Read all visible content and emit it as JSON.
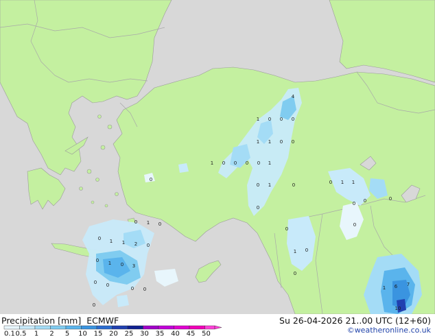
{
  "legend": {
    "title": "Precipitation [mm]",
    "model": "ECMWF",
    "datetime": "Su 26-04-2026 21..00 UTC (12+60)",
    "credit": "©weatheronline.co.uk",
    "ticks": [
      "0.1",
      "0.5",
      "1",
      "2",
      "5",
      "10",
      "15",
      "20",
      "25",
      "30",
      "35",
      "40",
      "45",
      "50"
    ],
    "colors": [
      "#e8f6fc",
      "#c8eafa",
      "#a4dcf6",
      "#80ccf0",
      "#5ab4ec",
      "#3a94e0",
      "#2a6cd0",
      "#2040b0",
      "#102090",
      "#a000c8",
      "#c000d8",
      "#e000d0",
      "#f000b8",
      "#ff40d8"
    ]
  },
  "map": {
    "land_color": "#c4f0a0",
    "sea_color": "#d8d8d8",
    "border_color": "#a8a8a8",
    "values": [
      {
        "t": "4"
      },
      {
        "t": "1"
      },
      {
        "t": "0"
      },
      {
        "t": "0"
      },
      {
        "t": "0"
      },
      {
        "t": "1"
      },
      {
        "t": "1"
      },
      {
        "t": "0"
      },
      {
        "t": "0"
      },
      {
        "t": "1"
      },
      {
        "t": "0"
      },
      {
        "t": "0"
      },
      {
        "t": "0"
      },
      {
        "t": "0"
      },
      {
        "t": "1"
      },
      {
        "t": "0"
      },
      {
        "t": "0"
      },
      {
        "t": "1"
      },
      {
        "t": "0"
      },
      {
        "t": "0"
      },
      {
        "t": "0"
      },
      {
        "t": "1"
      },
      {
        "t": "1"
      },
      {
        "t": "0"
      },
      {
        "t": "0"
      },
      {
        "t": "0"
      },
      {
        "t": "1"
      },
      {
        "t": "0"
      },
      {
        "t": "0"
      },
      {
        "t": "1"
      },
      {
        "t": "1"
      },
      {
        "t": "2"
      },
      {
        "t": "0"
      },
      {
        "t": "0"
      },
      {
        "t": "0"
      },
      {
        "t": "1"
      },
      {
        "t": "0"
      },
      {
        "t": "3"
      },
      {
        "t": "0"
      },
      {
        "t": "0"
      },
      {
        "t": "0"
      },
      {
        "t": "0"
      },
      {
        "t": "0"
      },
      {
        "t": "0"
      },
      {
        "t": "0"
      },
      {
        "t": "1"
      },
      {
        "t": "0"
      },
      {
        "t": "1"
      },
      {
        "t": "6"
      },
      {
        "t": "7"
      },
      {
        "t": "10"
      },
      {
        "t": "0"
      }
    ]
  }
}
